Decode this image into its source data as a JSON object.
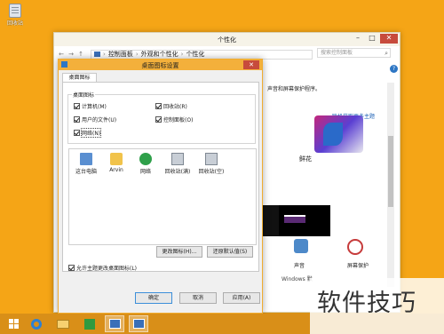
{
  "desktop": {
    "recycle_bin_label": "回收站"
  },
  "personalization": {
    "title": "个性化",
    "breadcrumb": [
      "控制面板",
      "外观和个性化",
      "个性化"
    ],
    "search_placeholder": "搜索控制面板",
    "heading": "声音和屏幕保护程序。",
    "online_themes_link": "联机获取更多主题",
    "theme_name": "鲜花",
    "sound_label": "声音",
    "screensaver_label": "屏幕保护",
    "sound_scheme": "Windows 默"
  },
  "dialog": {
    "title": "桌面图标设置",
    "tab": "桌面图标",
    "group_title": "桌面图标",
    "checkboxes": [
      {
        "label": "计算机(M)",
        "checked": true
      },
      {
        "label": "回收站(R)",
        "checked": true
      },
      {
        "label": "用户的文件(U)",
        "checked": true
      },
      {
        "label": "控制面板(O)",
        "checked": true
      },
      {
        "label": "网络(N)",
        "checked": true
      }
    ],
    "icons": [
      "这台电脑",
      "Arvin",
      "网络",
      "回收站(满)",
      "回收站(空)"
    ],
    "change_icon_button": "更改图标(H)...",
    "restore_default_button": "还原默认值(S)",
    "allow_themes_label": "允许主题更改桌面图标(L)",
    "allow_themes_checked": true,
    "ok_button": "确定",
    "cancel_button": "取消",
    "apply_button": "应用(A)"
  },
  "watermark": {
    "text": "软件技巧"
  },
  "colors": {
    "desktop": "#f5a516",
    "taskbar": "#d98f18",
    "dialog_title": "#f3b03b",
    "close": "#c74b3c"
  }
}
